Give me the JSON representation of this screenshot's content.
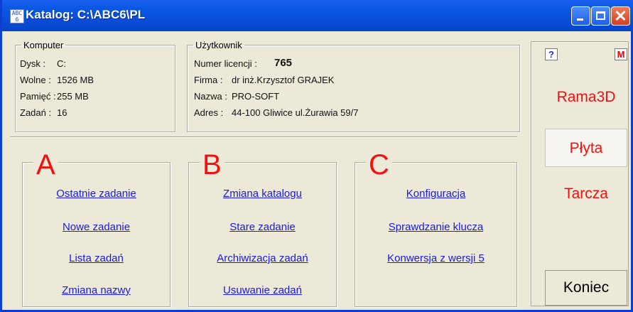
{
  "window": {
    "title": "Katalog: C:\\ABC6\\PL",
    "icon_text": "ABC 6",
    "controls": [
      "minimize-icon",
      "maximize-icon",
      "close-icon"
    ]
  },
  "komputer": {
    "legend": "Komputer",
    "rows": [
      {
        "label": "Dysk :",
        "value": "C:"
      },
      {
        "label": "Wolne :",
        "value": "1526 MB"
      },
      {
        "label": "Pamięć :",
        "value": "255 MB"
      },
      {
        "label": "Zadań :",
        "value": "16"
      }
    ]
  },
  "uzytkownik": {
    "legend": "Użytkownik",
    "licence_label": "Numer licencji :",
    "licence_value": "765",
    "rows": [
      {
        "label": "Firma :",
        "value": "dr inż.Krzysztof GRAJEK"
      },
      {
        "label": "Nazwa :",
        "value": "PRO-SOFT"
      },
      {
        "label": "Adres :",
        "value": "44-100 Gliwice ul.Żurawia 59/7"
      }
    ]
  },
  "groups": [
    {
      "letter": "A",
      "links": [
        "Ostatnie zadanie",
        "Nowe zadanie",
        "Lista zadań",
        "Zmiana nazwy"
      ]
    },
    {
      "letter": "B",
      "links": [
        "Zmiana katalogu",
        "Stare zadanie",
        "Archiwizacja zadań",
        "Usuwanie zadań"
      ]
    },
    {
      "letter": "C",
      "links": [
        "Konfiguracja",
        "Sprawdzanie klucza",
        "Konwersja z wersji 5"
      ]
    }
  ],
  "side": {
    "help_label": "?",
    "m_label": "M",
    "items": [
      "Rama3D",
      "Płyta",
      "Tarcza"
    ],
    "selected": "Płyta",
    "exit_label": "Koniec"
  },
  "colors": {
    "titlebar": "#0a4bd6",
    "letters": "#f51010",
    "links": "#1a1ae0",
    "side_items": "#ee1111"
  }
}
